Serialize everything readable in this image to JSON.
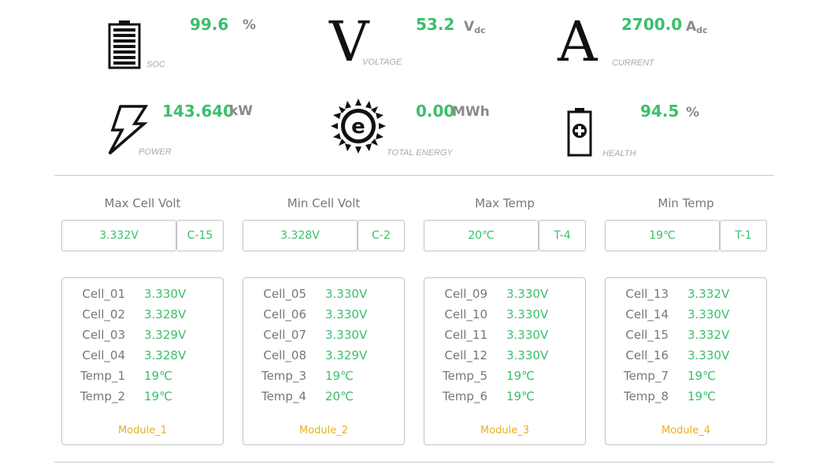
{
  "metrics": {
    "soc": {
      "value": "99.6",
      "unit": "%",
      "caption": "SOC"
    },
    "voltage": {
      "value": "53.2",
      "unit": "V",
      "unit_sub": "dc",
      "caption": "VOLTAGE",
      "symbol": "V"
    },
    "current": {
      "value": "2700.0",
      "unit": "A",
      "unit_sub": "dc",
      "caption": "CURRENT",
      "symbol": "A"
    },
    "power": {
      "value": "143.640",
      "unit": "kW",
      "caption": "POWER"
    },
    "energy": {
      "value": "0.00",
      "unit": "MWh",
      "caption": "TOTAL ENERGY",
      "symbol": "e"
    },
    "health": {
      "value": "94.5",
      "unit": "%",
      "caption": "HEALTH"
    }
  },
  "stats": [
    {
      "title": "Max Cell Volt",
      "value": "3.332V",
      "id": "C-15"
    },
    {
      "title": "Min Cell Volt",
      "value": "3.328V",
      "id": "C-2"
    },
    {
      "title": "Max Temp",
      "value": "20℃",
      "id": "T-4"
    },
    {
      "title": "Min Temp",
      "value": "19℃",
      "id": "T-1"
    }
  ],
  "modules": [
    {
      "name": "Module_1",
      "rows": [
        {
          "k": "Cell_01",
          "v": "3.330V"
        },
        {
          "k": "Cell_02",
          "v": "3.328V"
        },
        {
          "k": "Cell_03",
          "v": "3.329V"
        },
        {
          "k": "Cell_04",
          "v": "3.328V"
        },
        {
          "k": "Temp_1",
          "v": "19℃"
        },
        {
          "k": "Temp_2",
          "v": "19℃"
        }
      ]
    },
    {
      "name": "Module_2",
      "rows": [
        {
          "k": "Cell_05",
          "v": "3.330V"
        },
        {
          "k": "Cell_06",
          "v": "3.330V"
        },
        {
          "k": "Cell_07",
          "v": "3.330V"
        },
        {
          "k": "Cell_08",
          "v": "3.329V"
        },
        {
          "k": "Temp_3",
          "v": "19℃"
        },
        {
          "k": "Temp_4",
          "v": "20℃"
        }
      ]
    },
    {
      "name": "Module_3",
      "rows": [
        {
          "k": "Cell_09",
          "v": "3.330V"
        },
        {
          "k": "Cell_10",
          "v": "3.330V"
        },
        {
          "k": "Cell_11",
          "v": "3.330V"
        },
        {
          "k": "Cell_12",
          "v": "3.330V"
        },
        {
          "k": "Temp_5",
          "v": "19℃"
        },
        {
          "k": "Temp_6",
          "v": "19℃"
        }
      ]
    },
    {
      "name": "Module_4",
      "rows": [
        {
          "k": "Cell_13",
          "v": "3.332V"
        },
        {
          "k": "Cell_14",
          "v": "3.330V"
        },
        {
          "k": "Cell_15",
          "v": "3.332V"
        },
        {
          "k": "Cell_16",
          "v": "3.330V"
        },
        {
          "k": "Temp_7",
          "v": "19℃"
        },
        {
          "k": "Temp_8",
          "v": "19℃"
        }
      ]
    }
  ],
  "colors": {
    "value_green": "#3bbf6c",
    "module_label": "#e8b020",
    "border": "#c4c4c4"
  },
  "icons": [
    "battery-icon",
    "voltage-icon",
    "current-icon",
    "lightning-icon",
    "energy-icon",
    "battery-health-icon"
  ]
}
